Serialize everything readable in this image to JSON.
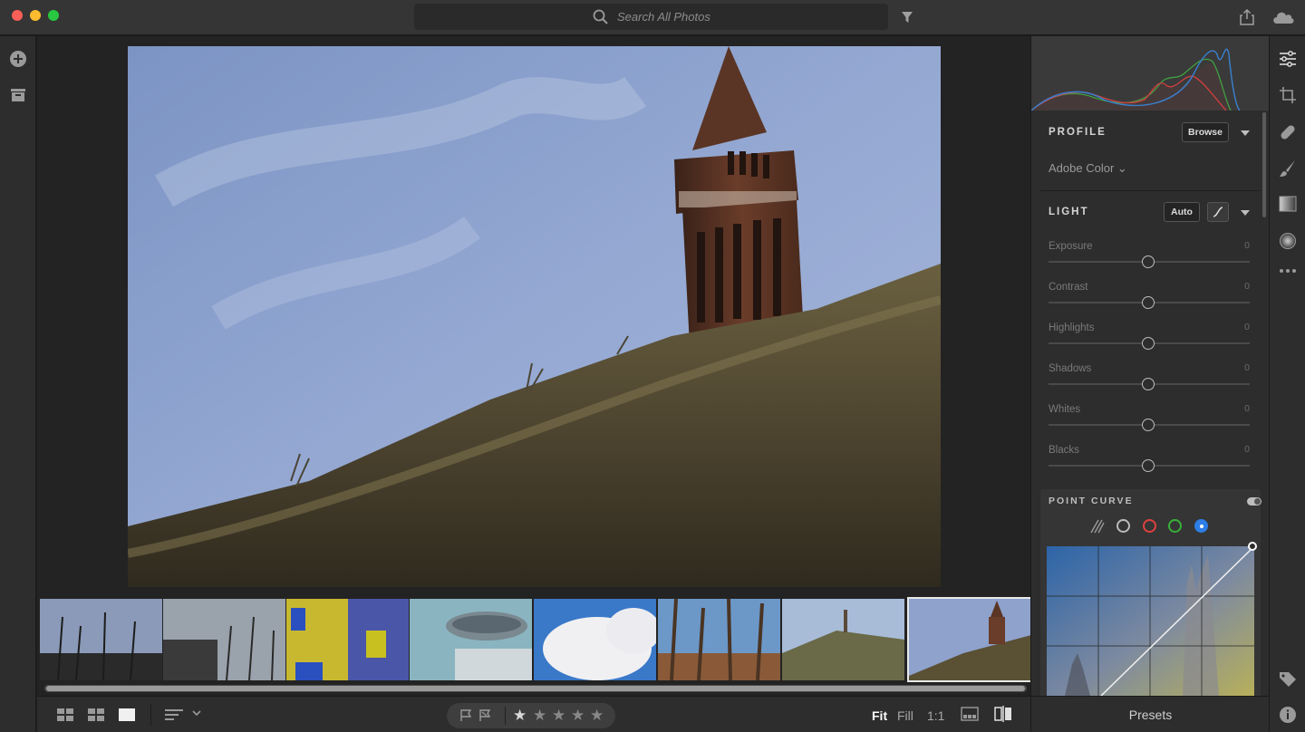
{
  "window": {
    "traffic_lights": {
      "close": "#fe5f57",
      "minimize": "#febc2e",
      "zoom": "#28c840"
    }
  },
  "search": {
    "placeholder": "Search All Photos"
  },
  "icons": {
    "search": "search-icon",
    "filter": "filter-icon",
    "share": "share-icon",
    "cloud": "cloud-icon",
    "add": "add-photos-icon",
    "library": "library-icon"
  },
  "main_photo": {
    "subject": "brick tower on grassy hill",
    "selected_index": 7
  },
  "filmstrip": {
    "thumbnails": [
      {
        "name": "thumb-plants-sky"
      },
      {
        "name": "thumb-plants-tower"
      },
      {
        "name": "thumb-yellow-facade"
      },
      {
        "name": "thumb-grill"
      },
      {
        "name": "thumb-clouds"
      },
      {
        "name": "thumb-trees"
      },
      {
        "name": "thumb-hill-tower"
      },
      {
        "name": "thumb-tower-grass"
      }
    ]
  },
  "bottom_toolbar": {
    "stars": [
      "★",
      "★",
      "★",
      "★",
      "★"
    ],
    "zoom": {
      "fit": "Fit",
      "fill": "Fill",
      "one_to_one": "1:1"
    }
  },
  "right_panel": {
    "profile": {
      "title": "PROFILE",
      "browse": "Browse",
      "value": "Adobe Color"
    },
    "light": {
      "title": "LIGHT",
      "auto": "Auto",
      "sliders": [
        {
          "label": "Exposure",
          "value": "0"
        },
        {
          "label": "Contrast",
          "value": "0"
        },
        {
          "label": "Highlights",
          "value": "0"
        },
        {
          "label": "Shadows",
          "value": "0"
        },
        {
          "label": "Whites",
          "value": "0"
        },
        {
          "label": "Blacks",
          "value": "0"
        }
      ]
    },
    "point_curve": {
      "title": "POINT CURVE",
      "channels": [
        "#bbbbbb",
        "#e04040",
        "#38b038",
        "#2d7ee6"
      ]
    },
    "presets": "Presets"
  },
  "tool_rail": {
    "icons": [
      "edit-icon",
      "crop-icon",
      "healing-icon",
      "brush-icon",
      "linear-gradient-icon",
      "radial-gradient-icon",
      "more-icon",
      "keyword-icon",
      "info-icon"
    ]
  }
}
